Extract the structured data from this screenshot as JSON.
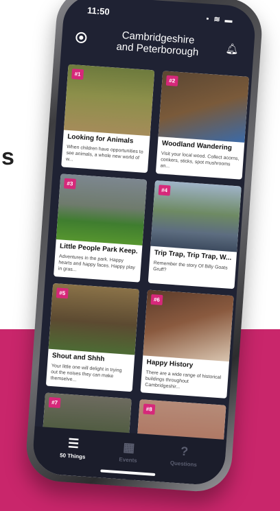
{
  "background_text": {
    "s_char": "s"
  },
  "status": {
    "time": "11:50",
    "icons": "▪ ≋ ▬"
  },
  "header": {
    "title_line1": "Cambridgeshire",
    "title_line2": "and Peterborough"
  },
  "cards": [
    {
      "badge": "#1",
      "title": "Looking for Animals",
      "desc": "When children have opportunities to see animals, a whole new world of w..."
    },
    {
      "badge": "#2",
      "title": "Woodland Wandering",
      "desc": "Visit your local wood. Collect acorns, conkers, sticks, spot mushrooms an..."
    },
    {
      "badge": "#3",
      "title": "Little People Park Keep...",
      "desc": "Adventures in the park. Happy hearts and happy faces. Happy play in gras..."
    },
    {
      "badge": "#4",
      "title": "Trip Trap, Trip Trap, W...",
      "desc": "Remember the story Of Billy Goats Gruff?"
    },
    {
      "badge": "#5",
      "title": "Shout and Shhh",
      "desc": "Your little one will delight in trying out the noises they can make themselve..."
    },
    {
      "badge": "#6",
      "title": "Happy History",
      "desc": "There are a wide range of historical buildings throughout Cambridgeshir..."
    },
    {
      "badge": "#7",
      "title": "",
      "desc": ""
    },
    {
      "badge": "#8",
      "title": "",
      "desc": ""
    }
  ],
  "tabs": [
    {
      "label": "50 Things",
      "icon": "list-icon",
      "glyph": "☰"
    },
    {
      "label": "Events",
      "icon": "calendar-icon",
      "glyph": "▦"
    },
    {
      "label": "Questions",
      "icon": "question-icon",
      "glyph": "?"
    }
  ],
  "colors": {
    "accent": "#d6287a",
    "background_band": "#c9266b",
    "screen": "#1f2233"
  }
}
